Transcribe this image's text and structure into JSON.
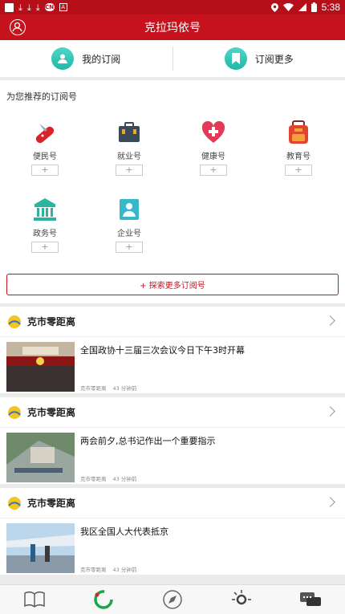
{
  "status_bar": {
    "time": "5:38",
    "badge_pill": "CN",
    "badge_a": "A",
    "icons": [
      "square-icon",
      "download-icon",
      "download-icon",
      "download-icon",
      "location-icon",
      "wifi-icon",
      "signal-icon",
      "battery-icon"
    ]
  },
  "app_bar": {
    "title": "克拉玛依号",
    "user_icon": "user-circle-icon"
  },
  "sub_bar": {
    "my_subscriptions": "我的订阅",
    "subscribe_more": "订阅更多"
  },
  "recommend": {
    "heading": "为您推荐的订阅号",
    "add_label": "+",
    "categories": [
      {
        "label": "便民号",
        "icon": "swiss-knife-icon"
      },
      {
        "label": "就业号",
        "icon": "briefcase-icon"
      },
      {
        "label": "健康号",
        "icon": "heart-plus-icon"
      },
      {
        "label": "教育号",
        "icon": "backpack-icon"
      },
      {
        "label": "政务号",
        "icon": "government-building-icon"
      },
      {
        "label": "企业号",
        "icon": "id-card-icon"
      }
    ],
    "explore_button": "+ 探索更多订阅号"
  },
  "feed": [
    {
      "source": "克市零距离",
      "headline": "全国政协十三届三次会议今日下午3时开幕",
      "meta_source": "克市零距离",
      "meta_time": "43 分钟前"
    },
    {
      "source": "克市零距离",
      "headline": "两会前夕,总书记作出一个重要指示",
      "meta_source": "克市零距离",
      "meta_time": "43 分钟前"
    },
    {
      "source": "克市零距离",
      "headline": "我区全国人大代表抵京",
      "meta_source": "克市零距离",
      "meta_time": "43 分钟前"
    }
  ],
  "bottom_tabs": [
    {
      "icon": "book-icon"
    },
    {
      "icon": "ring-loader-icon"
    },
    {
      "icon": "compass-icon"
    },
    {
      "icon": "sun-ring-icon"
    },
    {
      "icon": "chat-bubbles-icon"
    }
  ],
  "colors": {
    "brand_red": "#c5121c",
    "teal": "#1fb8a6"
  }
}
